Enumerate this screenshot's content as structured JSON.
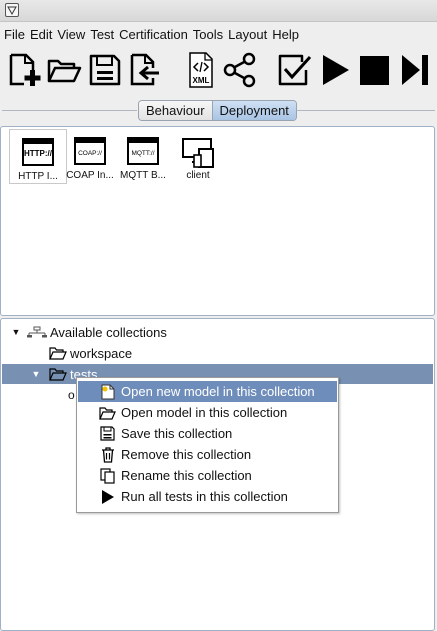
{
  "menubar": {
    "items": [
      "File",
      "Edit",
      "View",
      "Test",
      "Certification",
      "Tools",
      "Layout",
      "Help"
    ]
  },
  "toolbar": {
    "buttons": [
      {
        "icon": "new-file-icon"
      },
      {
        "icon": "open-folder-icon"
      },
      {
        "icon": "save-icon"
      },
      {
        "icon": "export-icon"
      },
      {
        "icon": "xml-file-icon",
        "label": "XML"
      },
      {
        "icon": "share-icon"
      },
      {
        "icon": "checkbox-icon"
      },
      {
        "icon": "play-icon"
      },
      {
        "icon": "stop-icon"
      },
      {
        "icon": "step-forward-icon"
      }
    ]
  },
  "tabs": {
    "behaviour": "Behaviour",
    "deployment": "Deployment",
    "active": "deployment"
  },
  "palette": {
    "components": [
      {
        "label": "HTTP I...",
        "icon_text": "HTTP://",
        "selected": true
      },
      {
        "label": "COAP In...",
        "icon_text": "COAP://",
        "selected": false
      },
      {
        "label": "MQTT B...",
        "icon_text": "MQTT://",
        "selected": false
      },
      {
        "label": "client",
        "icon": "devices-icon",
        "selected": false
      }
    ]
  },
  "tree": {
    "root_label": "Available collections",
    "workspace_label": "workspace",
    "tests_label": "tests",
    "child_label": "o"
  },
  "context_menu": {
    "items": [
      {
        "label": "Open new model in this collection",
        "icon": "new-model-icon",
        "highlighted": true
      },
      {
        "label": "Open model in this collection",
        "icon": "open-folder-icon"
      },
      {
        "label": "Save this collection",
        "icon": "save-icon"
      },
      {
        "label": "Remove this collection",
        "icon": "trash-icon"
      },
      {
        "label": "Rename this collection",
        "icon": "copy-icon"
      },
      {
        "label": "Run all tests in this collection",
        "icon": "play-icon"
      }
    ]
  },
  "colors": {
    "selection": "#7891b3",
    "menu_highlight": "#6f8dba",
    "panel_border": "#9fb0c7",
    "active_tab": "#b8cfea"
  }
}
